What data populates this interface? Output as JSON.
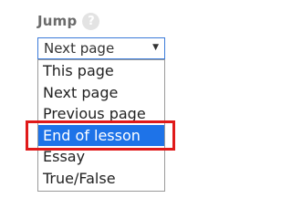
{
  "field": {
    "label": "Jump",
    "help_icon": "?",
    "help_icon_name": "help-icon"
  },
  "select": {
    "value": "Next page",
    "arrow_icon": "▼"
  },
  "dropdown": {
    "options": [
      {
        "label": "This page"
      },
      {
        "label": "Next page"
      },
      {
        "label": "Previous page"
      },
      {
        "label": "End of lesson",
        "selected": true
      },
      {
        "label": "Essay"
      },
      {
        "label": "True/False"
      }
    ]
  },
  "colors": {
    "label_text": "#6b6b6b",
    "select_border": "#3b7bd9",
    "selected_option_bg": "#1e73e8",
    "highlight_border": "#e01a1a"
  }
}
